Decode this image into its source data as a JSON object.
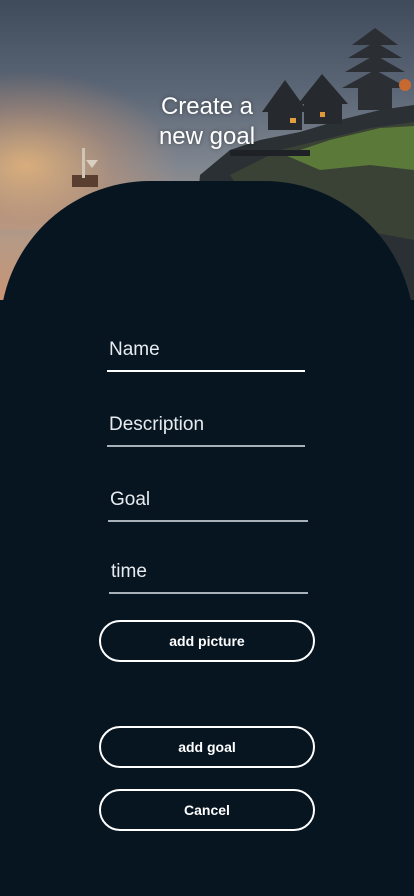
{
  "header": {
    "title_line1": "Create a",
    "title_line2": "new goal"
  },
  "form": {
    "name": {
      "placeholder": "Name",
      "value": ""
    },
    "description": {
      "placeholder": "Description",
      "value": ""
    },
    "goal": {
      "placeholder": "Goal",
      "value": ""
    },
    "time": {
      "placeholder": "time",
      "value": ""
    }
  },
  "buttons": {
    "add_picture": "add picture",
    "add_goal": "add goal",
    "cancel": "Cancel"
  },
  "colors": {
    "panel_bg": "#071520",
    "text": "#ffffff",
    "underline": "#a8b0b8"
  }
}
